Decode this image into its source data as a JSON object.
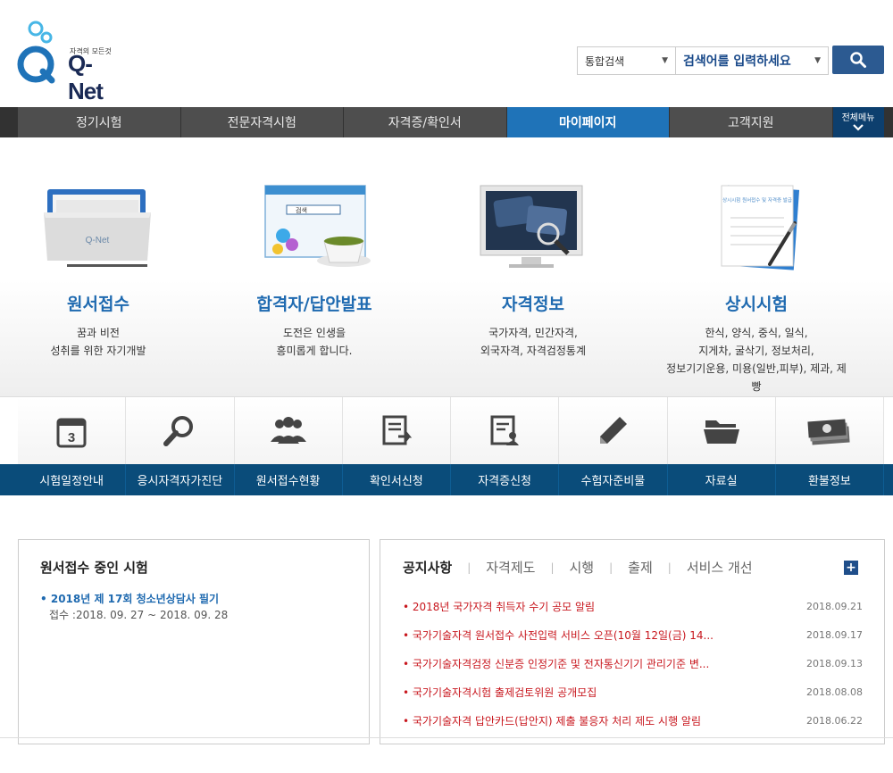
{
  "header": {
    "logo_slogan": "자격의 모든것",
    "logo_text": "Q-Net",
    "search_scope": "통합검색",
    "search_placeholder": "검색어를 입력하세요"
  },
  "nav": {
    "items": [
      "정기시험",
      "전문자격시험",
      "자격증/확인서",
      "마이페이지",
      "고객지원"
    ],
    "active_index": 3,
    "all_menu": "전체메뉴"
  },
  "features": [
    {
      "title": "원서접수",
      "lines": [
        "꿈과 비전",
        "성취를 위한 자기개발"
      ]
    },
    {
      "title": "합격자/답안발표",
      "lines": [
        "도전은 인생을",
        "흥미롭게 합니다."
      ]
    },
    {
      "title": "자격정보",
      "lines": [
        "국가자격, 민간자격,",
        "외국자격, 자격검정통계"
      ]
    },
    {
      "title": "상시시험",
      "lines": [
        "한식, 양식, 중식, 일식,",
        "지게차, 굴삭기, 정보처리,",
        "정보기기운용, 미용(일반,피부), 제과, 제빵"
      ]
    }
  ],
  "feature_images": {
    "f1_logo": "Q-Net",
    "f2_search": "검색",
    "f4_doc": "상시시험 원서접수 및 자격증 발급"
  },
  "quick_menu": [
    {
      "label": "시험일정안내",
      "icon": "calendar-icon",
      "calendar_day": "3"
    },
    {
      "label": "응시자격자가진단",
      "icon": "magnifier-icon"
    },
    {
      "label": "원서접수현황",
      "icon": "people-icon"
    },
    {
      "label": "확인서신청",
      "icon": "document-arrow-icon"
    },
    {
      "label": "자격증신청",
      "icon": "document-user-icon"
    },
    {
      "label": "수험자준비물",
      "icon": "pencil-icon"
    },
    {
      "label": "자료실",
      "icon": "folder-icon"
    },
    {
      "label": "환불정보",
      "icon": "money-icon"
    }
  ],
  "exams_panel": {
    "title": "원서접수 중인 시험",
    "item": "• 2018년 제 17회 청소년상담사 필기",
    "period": "접수 :2018. 09. 27 ~ 2018. 09. 28"
  },
  "notice_panel": {
    "tabs": [
      "공지사항",
      "자격제도",
      "시행",
      "출제",
      "서비스 개선"
    ],
    "active_tab": 0,
    "more": "+",
    "notices": [
      {
        "title": "• 2018년 국가자격 취득자 수기 공모 알림",
        "date": "2018.09.21"
      },
      {
        "title": "• 국가기술자격 원서접수 사전입력 서비스 오픈(10월 12일(금) 14...",
        "date": "2018.09.17"
      },
      {
        "title": "• 국가기술자격검정 신분증 인정기준 및 전자통신기기 관리기준 변...",
        "date": "2018.09.13"
      },
      {
        "title": "• 국가기술자격시험 출제검토위원 공개모집",
        "date": "2018.08.08"
      },
      {
        "title": "• 국가기술자격 답안카드(답안지) 제출 불응자 처리 제도 시행 알림",
        "date": "2018.06.22"
      }
    ]
  },
  "colors": {
    "brand_blue": "#1f6ab0",
    "nav_dark": "#4e4e4e",
    "nav_active": "#1f73b8",
    "quick_bar": "#0a4c7a",
    "notice_red": "#c8171e"
  }
}
